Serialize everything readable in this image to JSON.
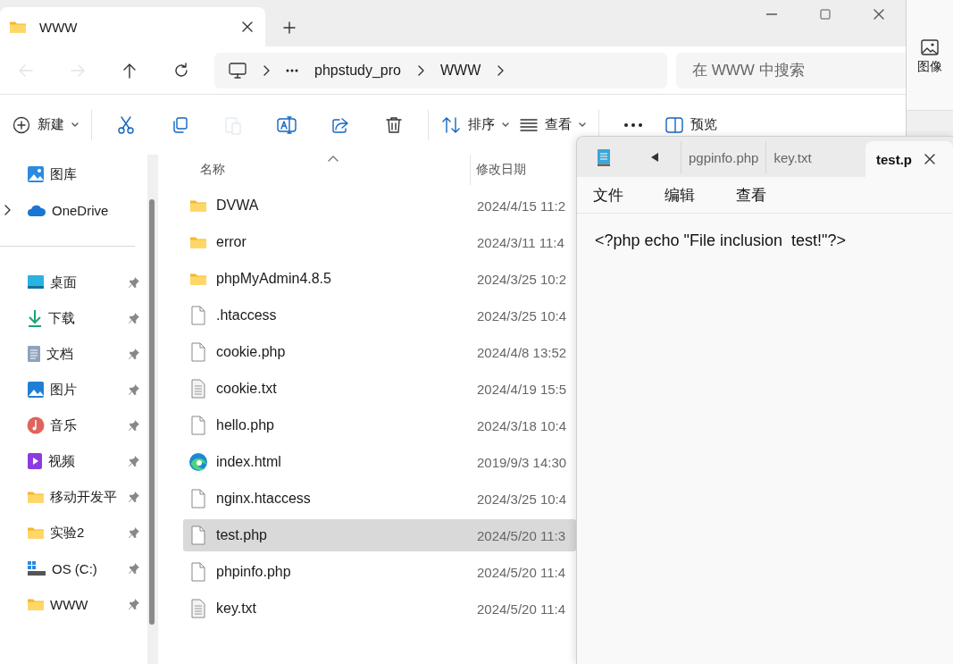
{
  "explorer": {
    "tab": {
      "title": "WWW"
    },
    "nav_buttons": [
      {
        "kind": "back",
        "disabled": true
      },
      {
        "kind": "forward",
        "disabled": true
      },
      {
        "kind": "up",
        "disabled": false
      },
      {
        "kind": "refresh",
        "disabled": false
      }
    ],
    "breadcrumbs": [
      "phpstudy_pro",
      "WWW"
    ],
    "search": {
      "placeholder": "在 WWW 中搜索"
    },
    "toolbar": [
      {
        "kind": "new",
        "label": "新建",
        "disabled": false
      },
      {
        "kind": "cut",
        "disabled": false
      },
      {
        "kind": "copy",
        "disabled": false
      },
      {
        "kind": "paste",
        "disabled": true
      },
      {
        "kind": "rename",
        "disabled": false
      },
      {
        "kind": "share",
        "disabled": false
      },
      {
        "kind": "delete",
        "disabled": false
      },
      {
        "kind": "sort",
        "label": "排序",
        "disabled": false
      },
      {
        "kind": "view",
        "label": "查看",
        "disabled": false
      },
      {
        "kind": "more",
        "disabled": false
      },
      {
        "kind": "preview",
        "label": "预览",
        "disabled": false
      }
    ],
    "sidebar": {
      "items": [
        {
          "label": "图库",
          "kind": "gallery",
          "pinned": false
        },
        {
          "label": "OneDrive",
          "kind": "cloud",
          "pinned": false,
          "expanded": false
        },
        {
          "label": "桌面",
          "kind": "desktop",
          "pinned": true
        },
        {
          "label": "下载",
          "kind": "download",
          "pinned": true
        },
        {
          "label": "文档",
          "kind": "documents",
          "pinned": true
        },
        {
          "label": "图片",
          "kind": "pictures",
          "pinned": true
        },
        {
          "label": "音乐",
          "kind": "music",
          "pinned": true
        },
        {
          "label": "视频",
          "kind": "videos",
          "pinned": true
        },
        {
          "label": "移动开发平",
          "kind": "folder",
          "pinned": true
        },
        {
          "label": "实验2",
          "kind": "folder",
          "pinned": true
        },
        {
          "label": "OS (C:)",
          "kind": "drive",
          "pinned": true
        },
        {
          "label": "WWW",
          "kind": "folder",
          "pinned": true
        }
      ]
    },
    "columns": [
      "名称",
      "修改日期"
    ],
    "files": [
      {
        "name": "DVWA",
        "kind": "folder",
        "date": "2024/4/15 11:2",
        "selected": false
      },
      {
        "name": "error",
        "kind": "folder",
        "date": "2024/3/11 11:4",
        "selected": false
      },
      {
        "name": "phpMyAdmin4.8.5",
        "kind": "folder",
        "date": "2024/3/25 10:2",
        "selected": false
      },
      {
        "name": ".htaccess",
        "kind": "file",
        "date": "2024/3/25 10:4",
        "selected": false
      },
      {
        "name": "cookie.php",
        "kind": "file",
        "date": "2024/4/8 13:52",
        "selected": false
      },
      {
        "name": "cookie.txt",
        "kind": "text",
        "date": "2024/4/19 15:5",
        "selected": false
      },
      {
        "name": "hello.php",
        "kind": "file",
        "date": "2024/3/18 10:4",
        "selected": false
      },
      {
        "name": "index.html",
        "kind": "edge",
        "date": "2019/9/3 14:30",
        "selected": false
      },
      {
        "name": "nginx.htaccess",
        "kind": "file",
        "date": "2024/3/25 10:4",
        "selected": false
      },
      {
        "name": "test.php",
        "kind": "file",
        "date": "2024/5/20 11:3",
        "selected": true
      },
      {
        "name": "phpinfo.php",
        "kind": "file",
        "date": "2024/5/20 11:4",
        "selected": false
      },
      {
        "name": "key.txt",
        "kind": "text",
        "date": "2024/5/20 11:4",
        "selected": false
      }
    ]
  },
  "side_window": {
    "button": "图像"
  },
  "notepad": {
    "tabs": [
      {
        "label": "pgpinfo.php",
        "selected": false
      },
      {
        "label": "key.txt",
        "selected": false
      },
      {
        "label": "test.p",
        "selected": true
      }
    ],
    "menu": [
      "文件",
      "编辑",
      "查看"
    ],
    "content": "<?php echo \"File inclusion  test!\"?>"
  }
}
